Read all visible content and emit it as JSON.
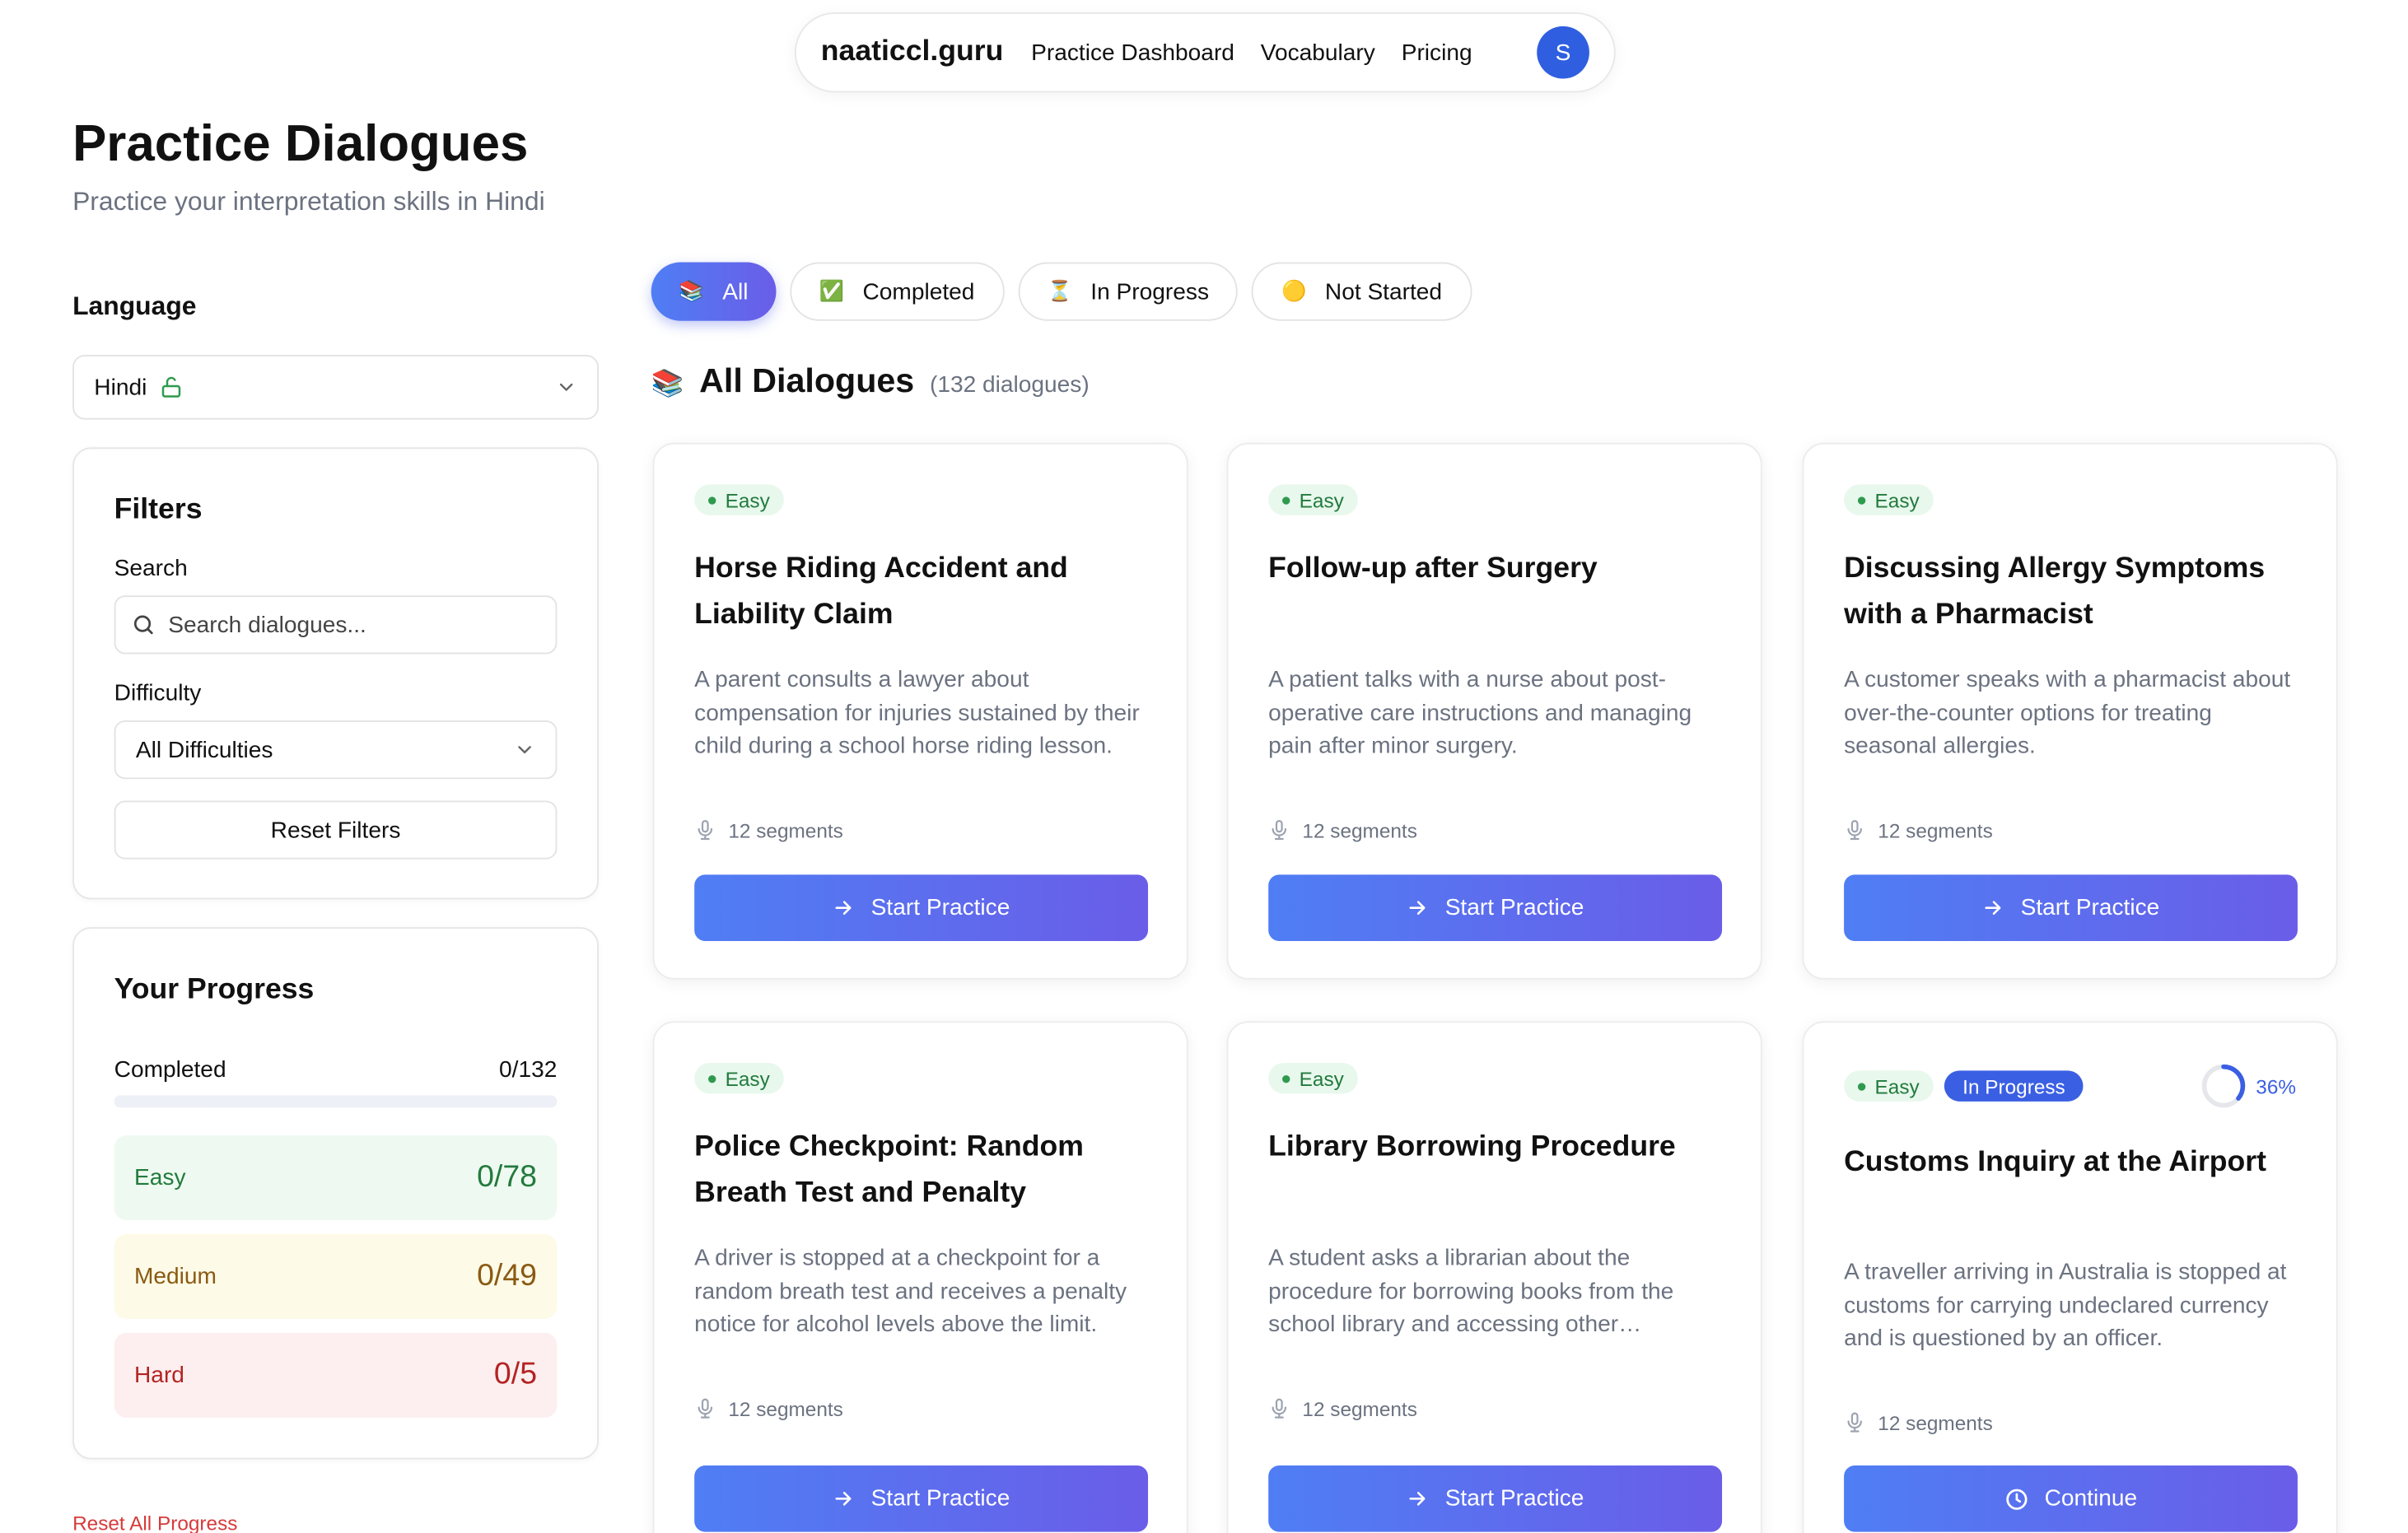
{
  "nav": {
    "brand": "naaticcl.guru",
    "links": [
      "Practice Dashboard",
      "Vocabulary",
      "Pricing"
    ],
    "avatar_initial": "S"
  },
  "page": {
    "title": "Practice Dialogues",
    "subtitle": "Practice your interpretation skills in Hindi"
  },
  "sidebar": {
    "language_label": "Language",
    "language_value": "Hindi",
    "filters": {
      "title": "Filters",
      "search_label": "Search",
      "search_placeholder": "Search dialogues...",
      "difficulty_label": "Difficulty",
      "difficulty_value": "All Difficulties",
      "reset_label": "Reset Filters"
    },
    "progress": {
      "title": "Your Progress",
      "completed_label": "Completed",
      "completed_value": "0/132",
      "completed_fraction": 0,
      "easy_label": "Easy",
      "easy_value": "0/78",
      "medium_label": "Medium",
      "medium_value": "0/49",
      "hard_label": "Hard",
      "hard_value": "0/5"
    },
    "reset_all_label": "Reset All Progress"
  },
  "tabs": [
    {
      "label": "All",
      "emoji": "📚"
    },
    {
      "label": "Completed",
      "emoji": "✅"
    },
    {
      "label": "In Progress",
      "emoji": "⏳"
    },
    {
      "label": "Not Started",
      "emoji": "🟡"
    }
  ],
  "section": {
    "emoji": "📚",
    "title": "All Dialogues",
    "count": "(132 dialogues)"
  },
  "cards": [
    {
      "difficulty": "Easy",
      "title": "Horse Riding Accident and Liability Claim",
      "description": "A parent consults a lawyer about compensation for injuries sustained by their child during a school horse riding lesson.",
      "segments": "12 segments",
      "cta": "Start Practice"
    },
    {
      "difficulty": "Easy",
      "title": "Follow-up after Surgery",
      "description": "A patient talks with a nurse about post-operative care instructions and managing pain after minor surgery.",
      "segments": "12 segments",
      "cta": "Start Practice"
    },
    {
      "difficulty": "Easy",
      "title": "Discussing Allergy Symptoms with a Pharmacist",
      "description": "A customer speaks with a pharmacist about over-the-counter options for treating seasonal allergies.",
      "segments": "12 segments",
      "cta": "Start Practice"
    },
    {
      "difficulty": "Easy",
      "title": "Police Checkpoint: Random Breath Test and Penalty",
      "description": "A driver is stopped at a checkpoint for a random breath test and receives a penalty notice for alcohol levels above the limit.",
      "segments": "12 segments",
      "cta": "Start Practice"
    },
    {
      "difficulty": "Easy",
      "title": "Library Borrowing Procedure",
      "description": "A student asks a librarian about the procedure for borrowing books from the school library and accessing other resources.",
      "segments": "12 segments",
      "cta": "Start Practice"
    },
    {
      "difficulty": "Easy",
      "status": "In Progress",
      "progress_label": "36%",
      "progress_fraction": 0.36,
      "title": "Customs Inquiry at the Airport",
      "description": "A traveller arriving in Australia is stopped at customs for carrying undeclared currency and is questioned by an officer.",
      "segments": "12 segments",
      "cta": "Continue"
    }
  ]
}
